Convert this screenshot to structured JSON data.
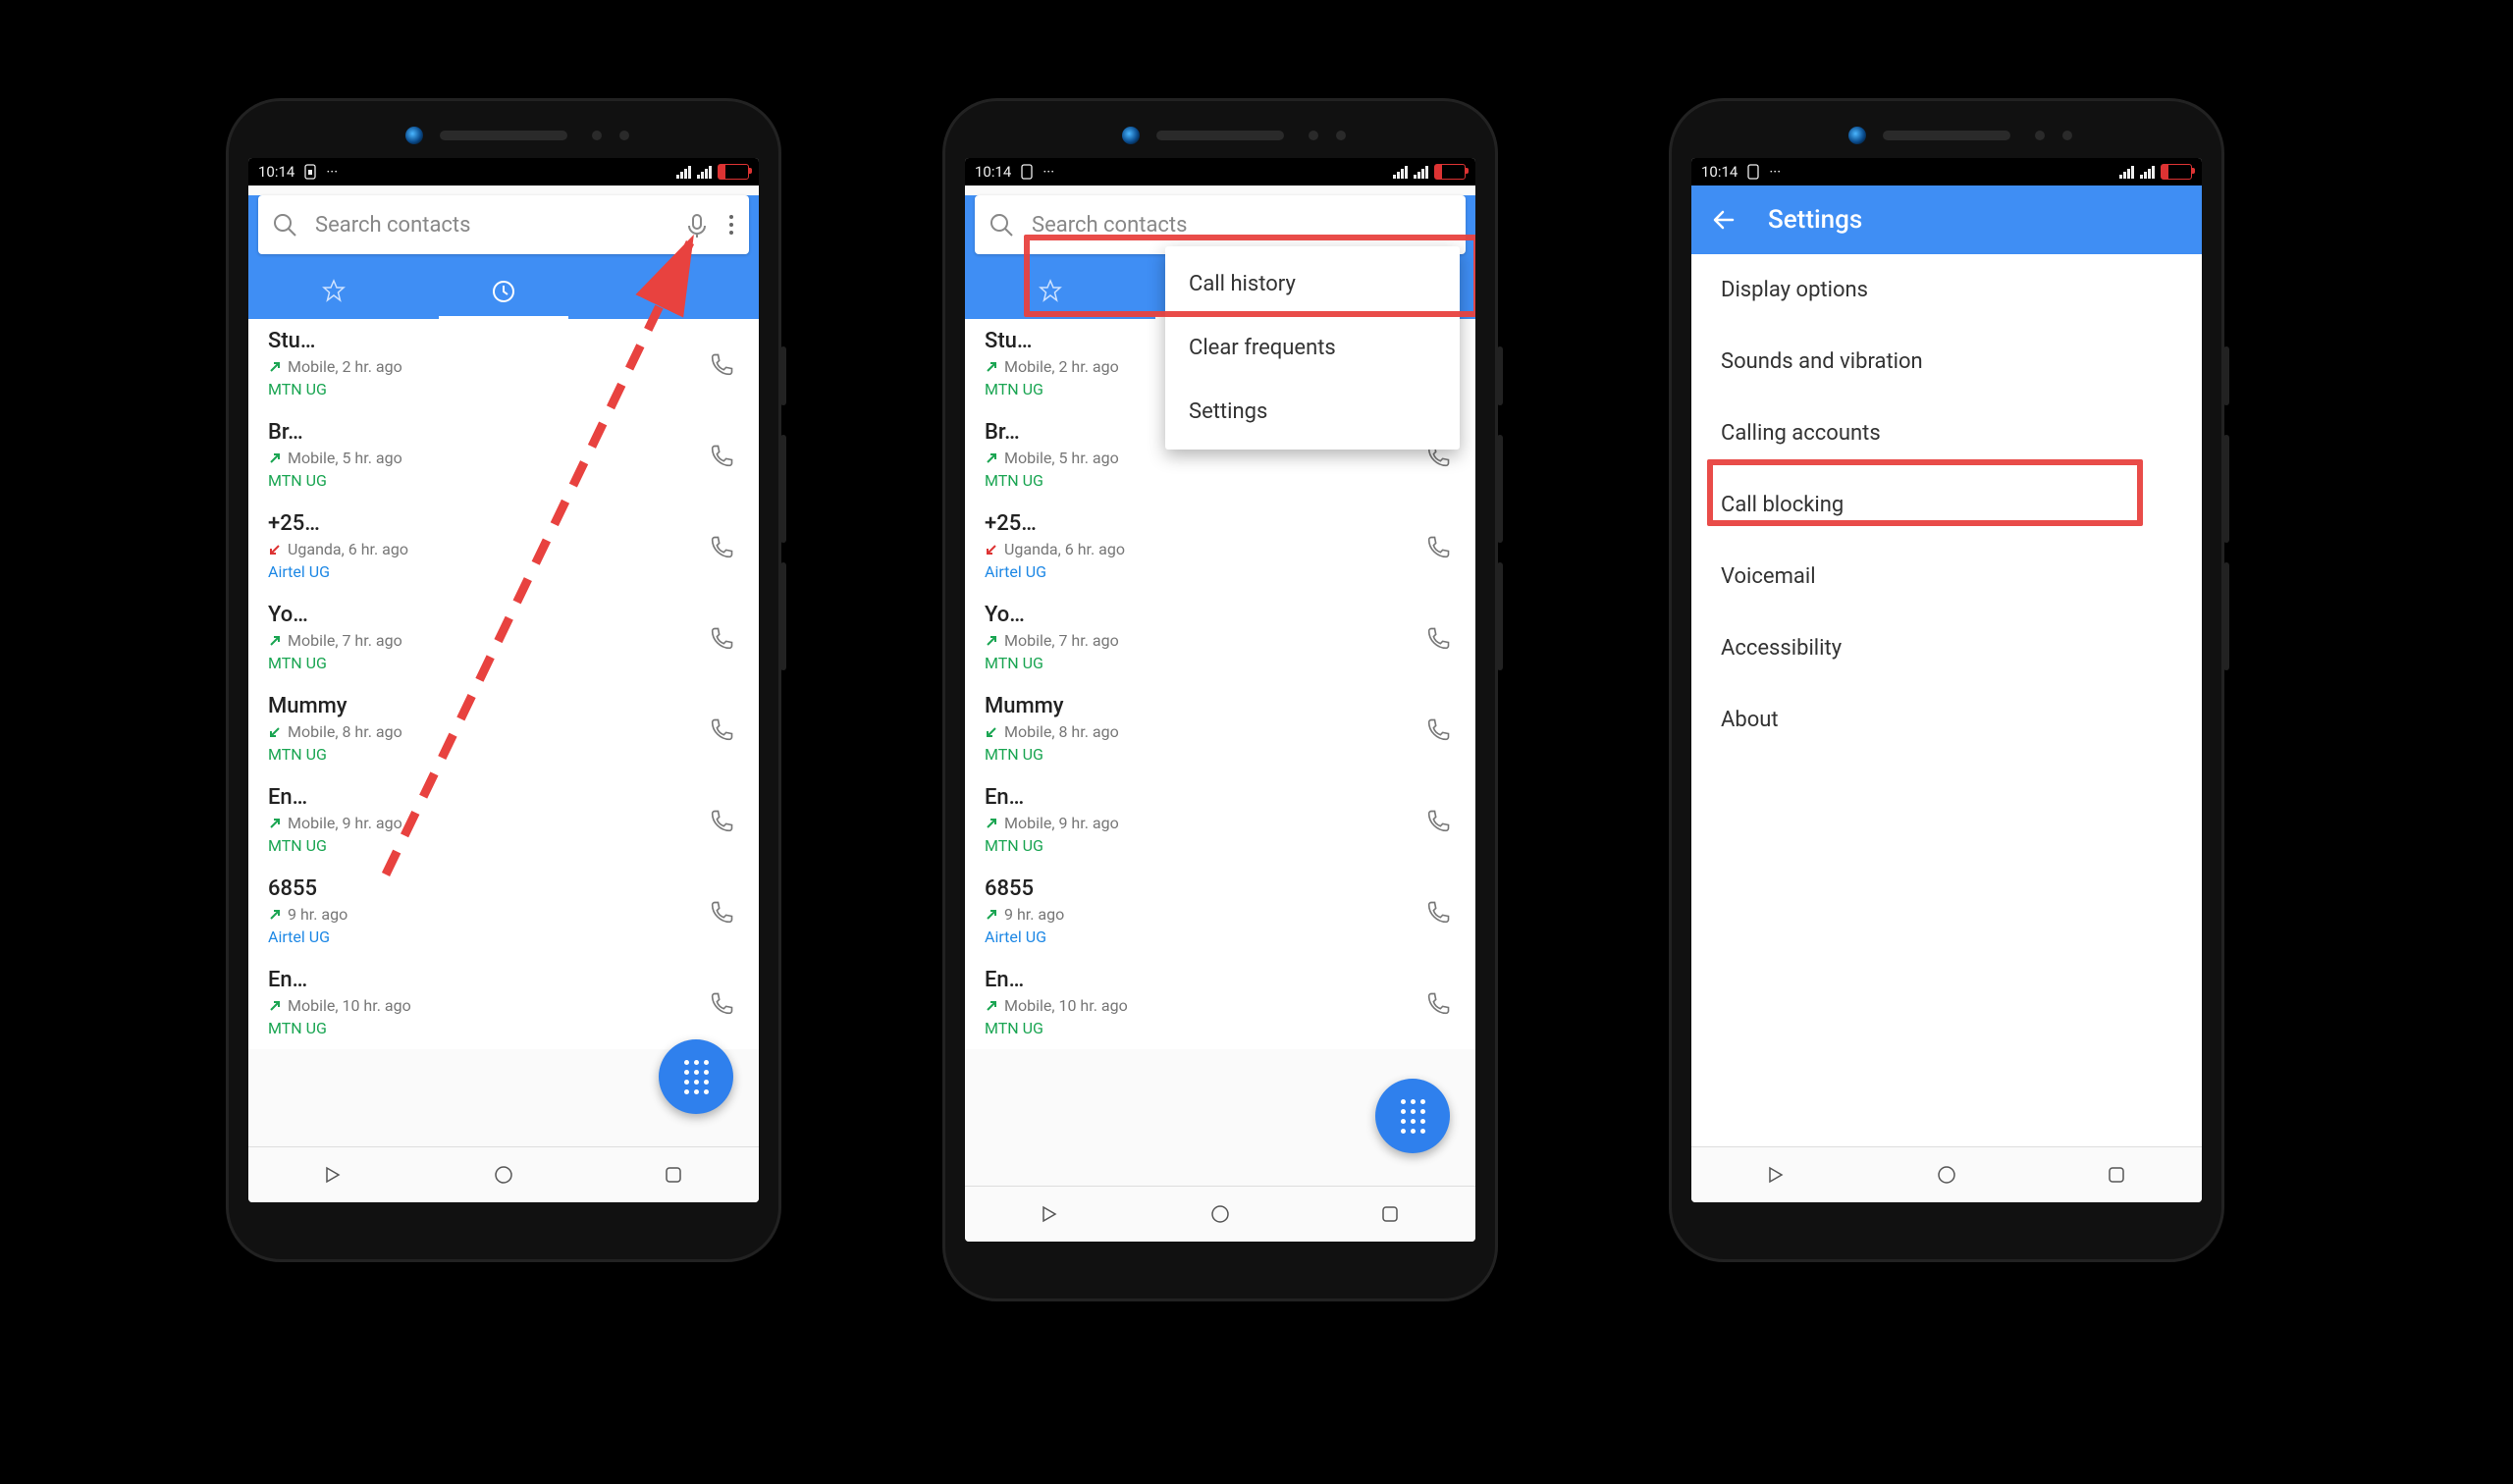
{
  "status": {
    "time": "10:14"
  },
  "search": {
    "placeholder": "Search contacts"
  },
  "tabs": {
    "star": "star-icon",
    "recent": "recent-icon",
    "contacts": "contacts-icon"
  },
  "calls": [
    {
      "name": "Stu…",
      "dir": "out-ok",
      "info": "Mobile, 2 hr. ago",
      "carrier": "MTN UG",
      "cclass": "mtn"
    },
    {
      "name": "Br…",
      "dir": "out-ok",
      "info": "Mobile, 5 hr. ago",
      "carrier": "MTN UG",
      "cclass": "mtn"
    },
    {
      "name": "+25…",
      "dir": "in-miss",
      "info": "Uganda, 6 hr. ago",
      "carrier": "Airtel UG",
      "cclass": "air"
    },
    {
      "name": "Yo…",
      "dir": "out-ok",
      "info": "Mobile, 7 hr. ago",
      "carrier": "MTN UG",
      "cclass": "mtn"
    },
    {
      "name": "Mummy",
      "dir": "in-ok",
      "info": "Mobile, 8 hr. ago",
      "carrier": "MTN UG",
      "cclass": "mtn"
    },
    {
      "name": "En…",
      "dir": "out-ok",
      "info": "Mobile, 9 hr. ago",
      "carrier": "MTN UG",
      "cclass": "mtn"
    },
    {
      "name": "6855",
      "dir": "out-ok",
      "info": "9 hr. ago",
      "carrier": "Airtel UG",
      "cclass": "air"
    },
    {
      "name": "En…",
      "dir": "out-ok",
      "info": "Mobile, 10 hr. ago",
      "carrier": "MTN UG",
      "cclass": "mtn"
    }
  ],
  "menu": {
    "history": "Call history",
    "clear": "Clear frequents",
    "settings": "Settings"
  },
  "settings": {
    "title": "Settings",
    "items": [
      "Display options",
      "Sounds and vibration",
      "Calling accounts",
      "Call blocking",
      "Voicemail",
      "Accessibility",
      "About"
    ]
  }
}
